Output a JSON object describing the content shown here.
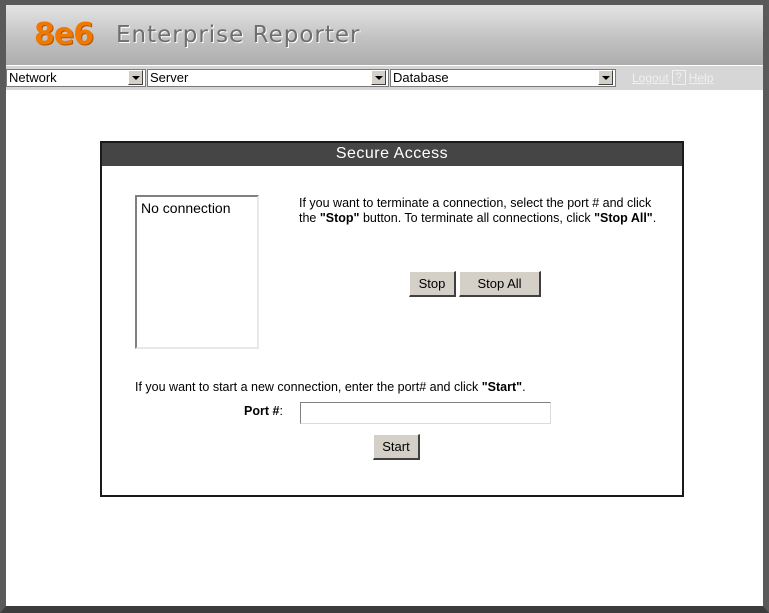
{
  "header": {
    "logo": "8e6",
    "title": "Enterprise Reporter"
  },
  "nav": {
    "network": "Network",
    "server": "Server",
    "database": "Database",
    "logout": "Logout",
    "help_icon": "?",
    "help": "Help"
  },
  "panel": {
    "title": "Secure Access",
    "connections": [
      "No connection"
    ],
    "info_part1": "If you want to terminate a connection, select the port # and click the ",
    "info_stop": "\"Stop\"",
    "info_part2": " button. To terminate all connections, click ",
    "info_stop_all": "\"Stop All\"",
    "info_part3": ".",
    "stop_button": "Stop",
    "stop_all_button": "Stop All",
    "start_text": "If you want to start a new connection, enter the port# and click ",
    "start_quote": "\"Start\"",
    "start_period": ".",
    "port_label_bold": "Port #",
    "port_label_colon": ":",
    "port_value": "",
    "start_button": "Start"
  }
}
